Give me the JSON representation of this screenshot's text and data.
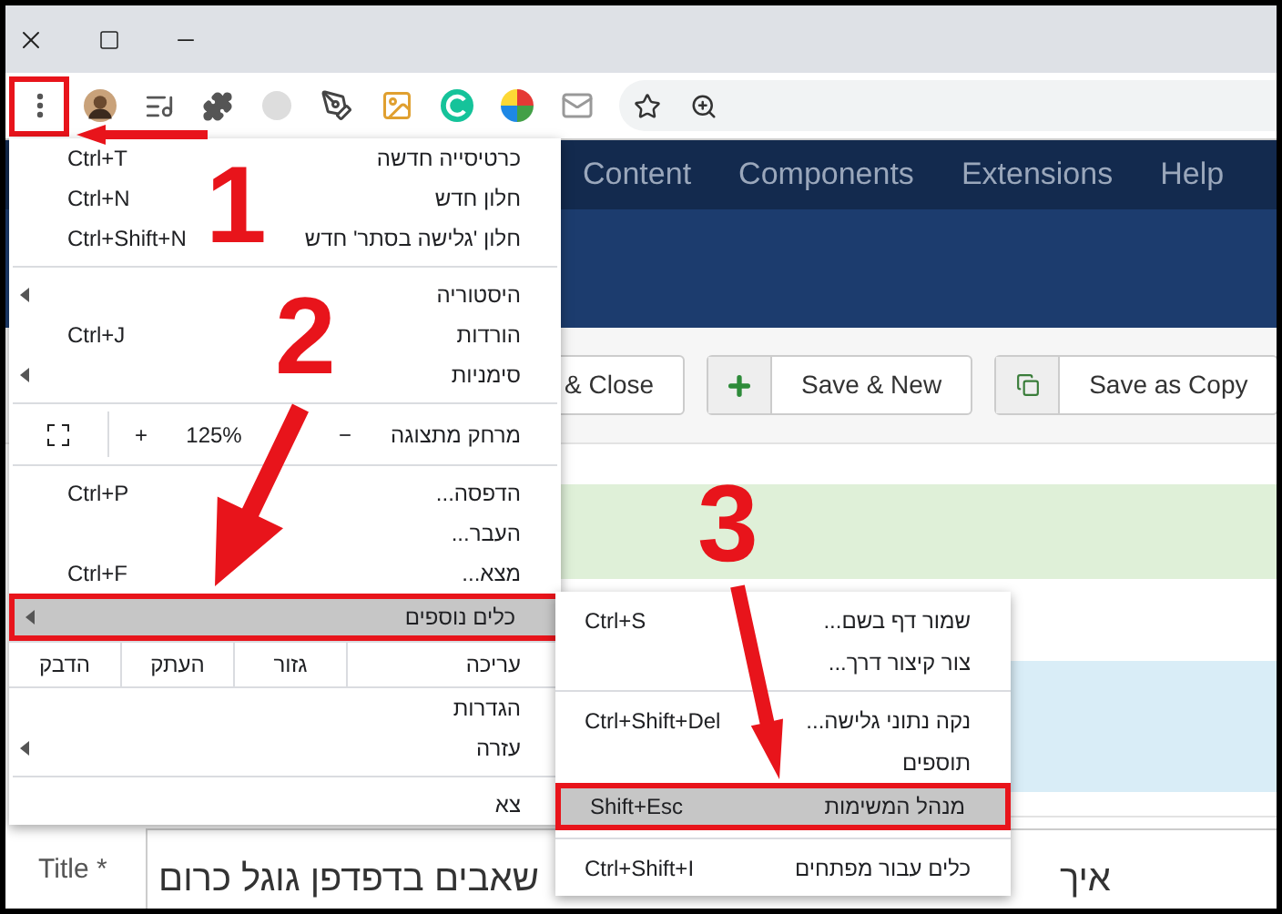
{
  "nav": {
    "items": [
      "Help",
      "Extensions",
      "Components",
      "Content"
    ]
  },
  "toolbar_buttons": [
    {
      "label": "Save as Copy",
      "kind": "copy"
    },
    {
      "label": "Save & New",
      "kind": "plus"
    },
    {
      "label": "& Close",
      "kind": "plain"
    }
  ],
  "title_field": {
    "label": "Title *",
    "value_start": "איך",
    "value_end": "שאבים בדפדפן גוגל כרום"
  },
  "main_menu": {
    "items": [
      {
        "kind": "item",
        "label": "כרטיסייה חדשה",
        "shortcut": "Ctrl+T",
        "submenu": false,
        "selected": false
      },
      {
        "kind": "item",
        "label": "חלון חדש",
        "shortcut": "Ctrl+N",
        "submenu": false,
        "selected": false
      },
      {
        "kind": "item",
        "label": "חלון 'גלישה בסתר' חדש",
        "shortcut": "Ctrl+Shift+N",
        "submenu": false,
        "selected": false
      },
      {
        "kind": "separator"
      },
      {
        "kind": "item",
        "label": "היסטוריה",
        "submenu": true,
        "selected": false
      },
      {
        "kind": "item",
        "label": "הורדות",
        "shortcut": "Ctrl+J",
        "submenu": false,
        "selected": false
      },
      {
        "kind": "item",
        "label": "סימניות",
        "submenu": true,
        "selected": false
      },
      {
        "kind": "separator"
      },
      {
        "kind": "zoom",
        "label": "מרחק מתצוגה",
        "minus": "−",
        "value": "125%",
        "plus": "+"
      },
      {
        "kind": "separator"
      },
      {
        "kind": "item",
        "label": "הדפסה...",
        "shortcut": "Ctrl+P",
        "submenu": false,
        "selected": false
      },
      {
        "kind": "item",
        "label": "העבר...",
        "submenu": false,
        "selected": false
      },
      {
        "kind": "item",
        "label": "מצא...",
        "shortcut": "Ctrl+F",
        "submenu": false,
        "selected": false
      },
      {
        "kind": "item",
        "label": "כלים נוספים",
        "submenu": true,
        "selected": true
      },
      {
        "kind": "edit",
        "label": "עריכה",
        "actions": [
          "גזור",
          "העתק",
          "הדבק"
        ]
      },
      {
        "kind": "item",
        "label": "הגדרות",
        "submenu": false,
        "selected": false
      },
      {
        "kind": "item",
        "label": "עזרה",
        "submenu": true,
        "selected": false
      },
      {
        "kind": "separator"
      },
      {
        "kind": "item",
        "label": "צא",
        "submenu": false,
        "selected": false
      }
    ]
  },
  "submenu": {
    "items": [
      {
        "kind": "item",
        "label": "שמור דף בשם...",
        "shortcut": "Ctrl+S",
        "selected": false
      },
      {
        "kind": "item",
        "label": "צור קיצור דרך...",
        "selected": false
      },
      {
        "kind": "separator"
      },
      {
        "kind": "item",
        "label": "נקה נתוני גלישה...",
        "shortcut": "Ctrl+Shift+Del",
        "selected": false
      },
      {
        "kind": "item",
        "label": "תוספים",
        "selected": false
      },
      {
        "kind": "item",
        "label": "מנהל המשימות",
        "shortcut": "Shift+Esc",
        "selected": true
      },
      {
        "kind": "separator"
      },
      {
        "kind": "item",
        "label": "כלים עבור מפתחים",
        "shortcut": "Ctrl+Shift+I",
        "selected": false
      }
    ]
  },
  "annotations": [
    {
      "number": "1"
    },
    {
      "number": "2"
    },
    {
      "number": "3"
    }
  ]
}
